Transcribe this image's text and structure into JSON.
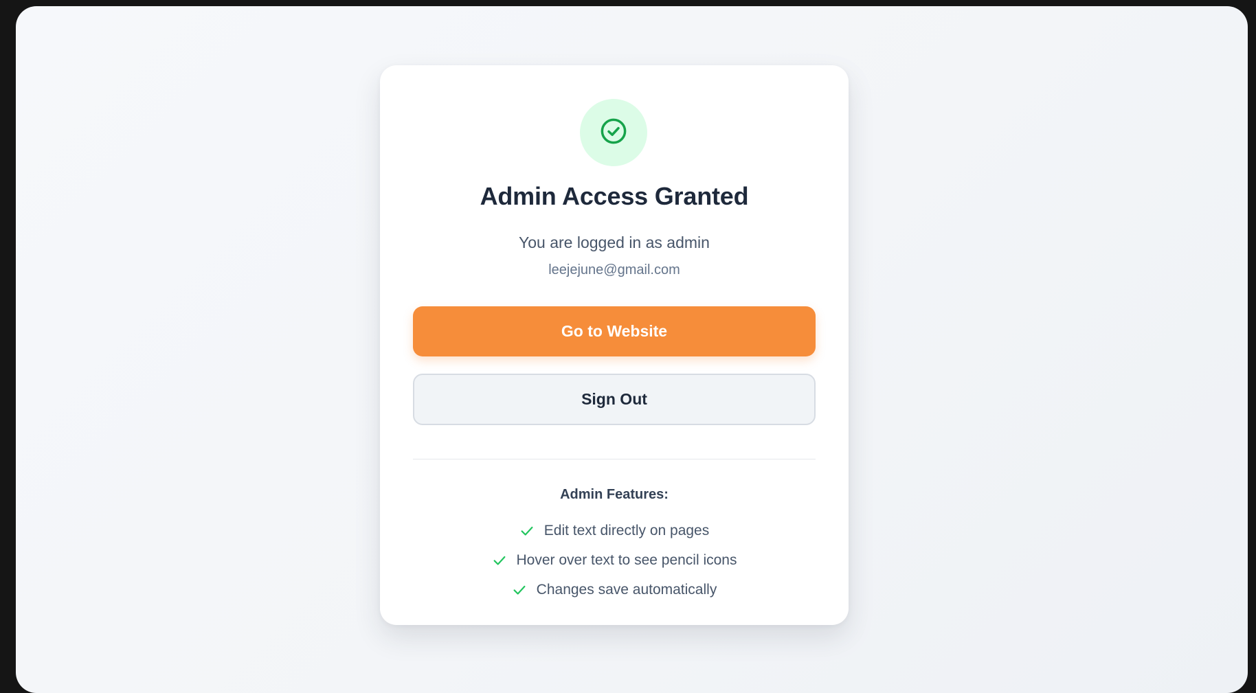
{
  "card": {
    "title": "Admin Access Granted",
    "subtitle": "You are logged in as admin",
    "email": "leejejune@gmail.com",
    "primary_button": "Go to Website",
    "secondary_button": "Sign Out",
    "features_heading": "Admin Features:",
    "features": [
      "Edit text directly on pages",
      "Hover over text to see pencil icons",
      "Changes save automatically"
    ]
  },
  "icons": {
    "badge": "check-circle-icon",
    "feature": "check-icon"
  },
  "colors": {
    "accent_orange": "#f68d3a",
    "success_green": "#16a34a",
    "success_bg": "#dcfce7",
    "title_text": "#1e293b"
  }
}
